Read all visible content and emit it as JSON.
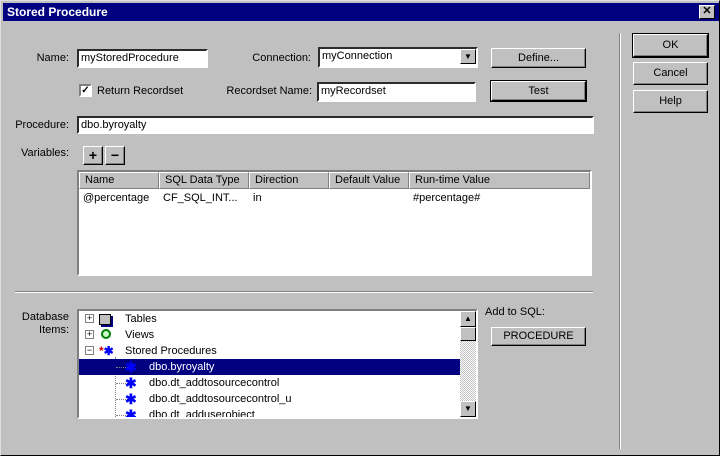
{
  "title": "Stored Procedure",
  "buttons": {
    "ok": "OK",
    "cancel": "Cancel",
    "help": "Help",
    "define": "Define...",
    "test": "Test",
    "add": "+",
    "remove": "−",
    "procedure": "PROCEDURE"
  },
  "form": {
    "name_label": "Name:",
    "name_value": "myStoredProcedure",
    "connection_label": "Connection:",
    "connection_value": "myConnection",
    "return_recordset_label": "Return Recordset",
    "return_recordset_checked": true,
    "recordset_name_label": "Recordset Name:",
    "recordset_name_value": "myRecordset",
    "procedure_label": "Procedure:",
    "procedure_value": "dbo.byroyalty",
    "variables_label": "Variables:"
  },
  "variables": {
    "columns": [
      "Name",
      "SQL Data Type",
      "Direction",
      "Default Value",
      "Run-time Value"
    ],
    "rows": [
      [
        "@percentage",
        "CF_SQL_INT...",
        "in",
        "",
        "#percentage#"
      ]
    ]
  },
  "database": {
    "label_line1": "Database",
    "label_line2": "Items:",
    "add_to_sql_label": "Add to SQL:",
    "tree": [
      {
        "label": "Tables",
        "icon": "table-icon",
        "expander": "+"
      },
      {
        "label": "Views",
        "icon": "view-icon",
        "expander": "+"
      },
      {
        "label": "Stored Procedures",
        "icon": "stored-procedures-icon",
        "expander": "−"
      },
      {
        "label": "dbo.byroyalty",
        "selected": true
      },
      {
        "label": "dbo.dt_addtosourcecontrol"
      },
      {
        "label": "dbo.dt_addtosourcecontrol_u"
      },
      {
        "label": "dbo.dt_adduserobject"
      }
    ]
  },
  "colors": {
    "titlebar": "#000080",
    "selection": "#000080",
    "face": "#c0c0c0"
  }
}
